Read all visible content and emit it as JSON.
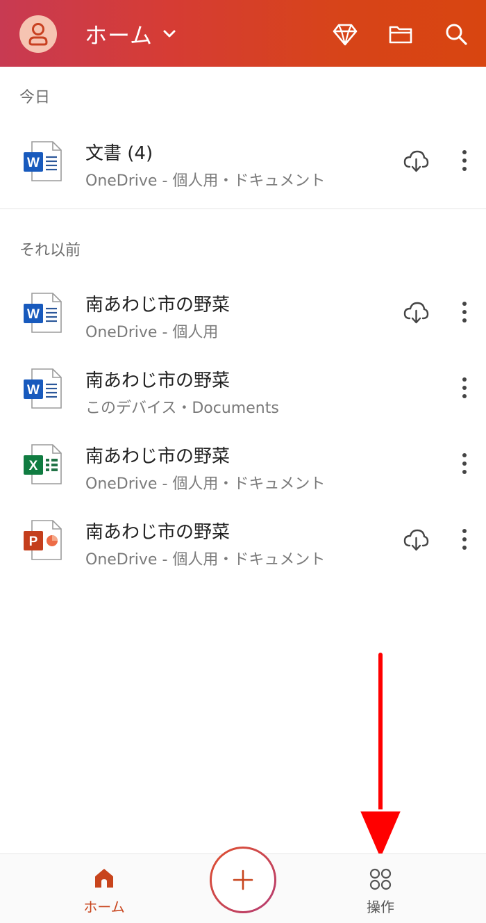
{
  "header": {
    "title": "ホーム",
    "colors": {
      "start": "#c83a52",
      "end": "#d84510"
    },
    "icons": [
      "avatar-icon",
      "chevron-down-icon",
      "diamond-icon",
      "folder-icon",
      "search-icon"
    ]
  },
  "sections": [
    {
      "label": "今日"
    },
    {
      "label": "それ以前"
    }
  ],
  "files": [
    {
      "name": "文書 (4)",
      "location": "OneDrive - 個人用・ドキュメント",
      "app": "word",
      "cloud": true
    },
    {
      "name": "南あわじ市の野菜",
      "location": "OneDrive - 個人用",
      "app": "word",
      "cloud": true
    },
    {
      "name": "南あわじ市の野菜",
      "location": "このデバイス・Documents",
      "app": "word",
      "cloud": false
    },
    {
      "name": "南あわじ市の野菜",
      "location": "OneDrive - 個人用・ドキュメント",
      "app": "excel",
      "cloud": false
    },
    {
      "name": "南あわじ市の野菜",
      "location": "OneDrive - 個人用・ドキュメント",
      "app": "powerpoint",
      "cloud": true
    }
  ],
  "bottom_nav": {
    "home_label": "ホーム",
    "actions_label": "操作",
    "add_icon": "plus-icon",
    "active_color": "#c8441c"
  },
  "annotation": {
    "icon": "red-arrow-down",
    "color": "#ff0000"
  }
}
